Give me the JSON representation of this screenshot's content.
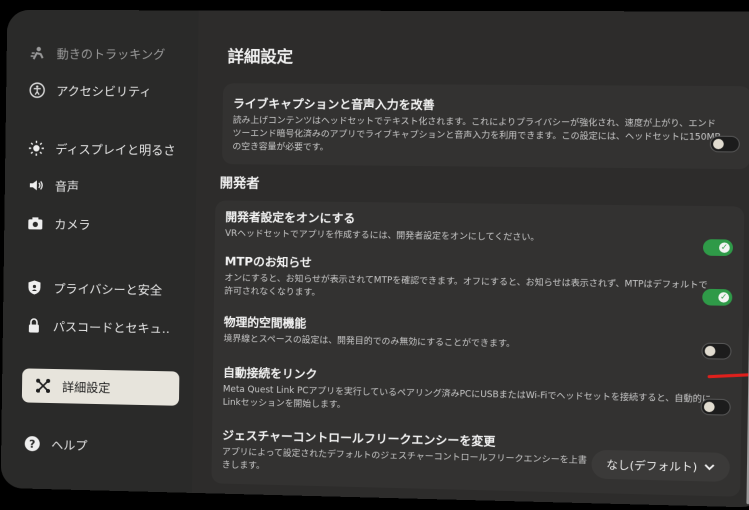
{
  "sidebar": {
    "items": [
      {
        "label": "動きのトラッキング",
        "icon": "motion-tracking-icon"
      },
      {
        "label": "アクセシビリティ",
        "icon": "accessibility-icon"
      },
      {
        "label": "ディスプレイと明るさ",
        "icon": "brightness-icon"
      },
      {
        "label": "音声",
        "icon": "speaker-icon"
      },
      {
        "label": "カメラ",
        "icon": "camera-icon"
      },
      {
        "label": "プライバシーと安全",
        "icon": "shield-icon"
      },
      {
        "label": "パスコードとセキュ‥",
        "icon": "lock-icon"
      },
      {
        "label": "詳細設定",
        "icon": "advanced-settings-icon"
      },
      {
        "label": "ヘルプ",
        "icon": "help-icon"
      }
    ],
    "active_index": 7
  },
  "main": {
    "page_title": "詳細設定",
    "section_developer": "開発者",
    "settings": [
      {
        "title": "ライブキャプションと音声入力を改善",
        "desc": "読み上げコンテンツはヘッドセットでテキスト化されます。これによりプライバシーが強化され、速度が上がり、エンドツーエンド暗号化済みのアプリでライブキャプションと音声入力を利用できます。この設定には、ヘッドセットに150MBの空き容量が必要です。",
        "toggle": "off"
      },
      {
        "title": "開発者設定をオンにする",
        "desc": "VRヘッドセットでアプリを作成するには、開発者設定をオンにしてください。",
        "toggle": "on"
      },
      {
        "title": "MTPのお知らせ",
        "desc": "オンにすると、お知らせが表示されてMTPを確認できます。オフにすると、お知らせは表示されず、MTPはデフォルトで許可されなくなります。",
        "toggle": "on"
      },
      {
        "title": "物理的空間機能",
        "desc": "境界線とスペースの設定は、開発目的でのみ無効にすることができます。",
        "toggle": "off"
      },
      {
        "title": "自動接続をリンク",
        "desc": "Meta Quest Link PCアプリを実行しているペアリング済みPCにUSBまたはWi-Fiでヘッドセットを接続すると、自動的にLinkセッションを開始します。",
        "toggle": "off"
      },
      {
        "title": "ジェスチャーコントロールフリークエンシーを変更",
        "desc": "アプリによって設定されたデフォルトのジェスチャーコントロールフリークエンシーを上書きします。",
        "select_value": "なし(デフォルト)"
      }
    ]
  },
  "colors": {
    "toggle_on": "#2f9a48",
    "annotation": "#e0201c",
    "active_nav_bg": "#e7e4dc"
  }
}
